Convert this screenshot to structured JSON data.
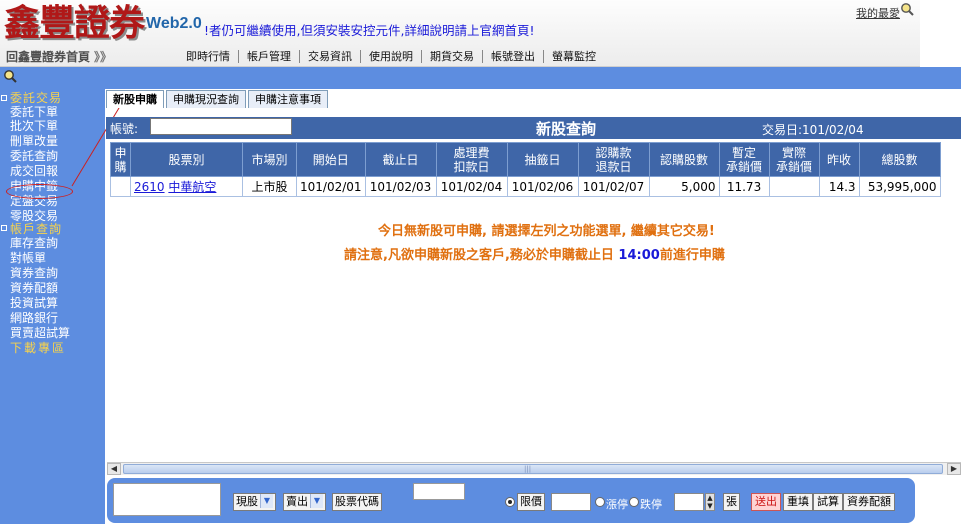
{
  "header": {
    "logo_text": "鑫豐證券",
    "logo_suffix": "Web2.0",
    "marquee": "!者仍可繼續使用,但須安裝安控元件,詳細說明請上官網首頁!",
    "favorites_link": "我的最愛",
    "home_link": "回鑫豐證券首頁",
    "home_arrows": "》》",
    "nav": [
      "即時行情",
      "帳戶管理",
      "交易資訊",
      "使用說明",
      "期貨交易",
      "帳號登出",
      "螢幕監控"
    ]
  },
  "sidebar": {
    "items": [
      {
        "label": "委託交易",
        "type": "category"
      },
      {
        "label": "委託下單",
        "type": "item"
      },
      {
        "label": "批次下單",
        "type": "item"
      },
      {
        "label": "刪單改量",
        "type": "item"
      },
      {
        "label": "委託查詢",
        "type": "item"
      },
      {
        "label": "成交回報",
        "type": "item"
      },
      {
        "label": "申購中籤",
        "type": "item"
      },
      {
        "label": "定盤交易",
        "type": "item"
      },
      {
        "label": "零股交易",
        "type": "item"
      },
      {
        "label": "帳戶查詢",
        "type": "category"
      },
      {
        "label": "庫存查詢",
        "type": "item"
      },
      {
        "label": "對帳單",
        "type": "item"
      },
      {
        "label": "資券查詢",
        "type": "item"
      },
      {
        "label": "資券配額",
        "type": "item"
      },
      {
        "label": "投資試算",
        "type": "item"
      },
      {
        "label": "網路銀行",
        "type": "item"
      },
      {
        "label": "買賣超試算",
        "type": "item"
      },
      {
        "label": "下載專區",
        "type": "download"
      }
    ]
  },
  "tabs": [
    "新股申購",
    "申購現況查詢",
    "申購注意事項"
  ],
  "title_bar": {
    "account_label": "帳號:",
    "title": "新股查詢",
    "trade_date": "交易日:101/02/04"
  },
  "table": {
    "headers": [
      "申購",
      "股票別",
      "市場別",
      "開始日",
      "截止日",
      "處理費扣款日",
      "抽籤日",
      "認購款退款日",
      "認購股數",
      "暫定承銷價",
      "實際承銷價",
      "昨收",
      "總股數"
    ],
    "headers_lines": [
      [
        "申",
        "購"
      ],
      [
        "股票別"
      ],
      [
        "市場別"
      ],
      [
        "開始日"
      ],
      [
        "截止日"
      ],
      [
        "處理費",
        "扣款日"
      ],
      [
        "抽籤日"
      ],
      [
        "認購款",
        "退款日"
      ],
      [
        "認購股數"
      ],
      [
        "暫定",
        "承銷價"
      ],
      [
        "實際",
        "承銷價"
      ],
      [
        "昨收"
      ],
      [
        "總股數"
      ]
    ],
    "rows": [
      {
        "apply": "",
        "stock_code": "2610",
        "stock_name": "中華航空",
        "market": "上市股",
        "start_date": "101/02/01",
        "end_date": "101/02/03",
        "fee_date": "101/02/04",
        "draw_date": "101/02/06",
        "refund_date": "101/02/07",
        "shares": "5,000",
        "temp_price": "11.73",
        "actual_price": "",
        "prev_close": "14.3",
        "total_shares": "53,995,000"
      }
    ]
  },
  "messages": {
    "line1": "今日無新股可申購, 請選擇左列之功能選單, 繼續其它交易!",
    "line2_pre": "請注意,凡欲申購新股之客戶,務必於申購截止日",
    "line2_time": "14:00",
    "line2_post": "前進行申購"
  },
  "order_bar": {
    "trade_type": "現股",
    "side": "賣出",
    "stock_code_label": "股票代碼",
    "price_type_label": "限價",
    "limit_up_label": "漲停",
    "limit_down_label": "跌停",
    "unit_label": "張",
    "send_button": "送出",
    "reset_button": "重填",
    "calc_button": "試算",
    "quota_button": "資券配額"
  },
  "colors": {
    "sidebar_bg": "#5d8de0",
    "title_bar_bg": "#3f66a8",
    "logo_red": "#b01818",
    "message_orange": "#e07010",
    "link_blue": "#1a1ad8",
    "category_yellow": "#f7d34d"
  },
  "icons": {
    "favorites": "magnifier-icon",
    "band": "magnifier-icon"
  }
}
